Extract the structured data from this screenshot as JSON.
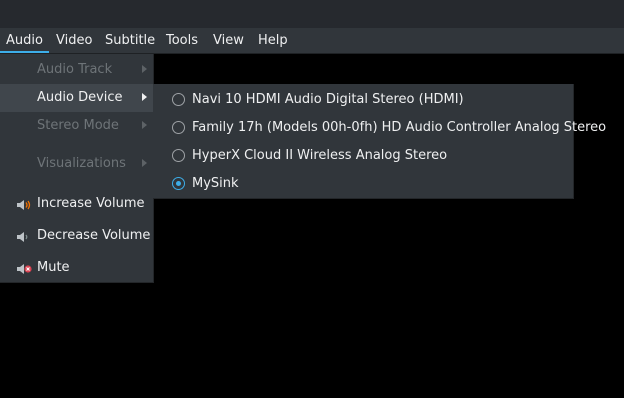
{
  "menubar": {
    "items": [
      {
        "label": "Audio"
      },
      {
        "label": "Video"
      },
      {
        "label": "Subtitle"
      },
      {
        "label": "Tools"
      },
      {
        "label": "View"
      },
      {
        "label": "Help"
      }
    ],
    "active": "Audio"
  },
  "audio_menu": {
    "items": [
      {
        "label": "Audio Track",
        "enabled": false,
        "has_submenu": true
      },
      {
        "label": "Audio Device",
        "enabled": true,
        "has_submenu": true,
        "highlighted": true
      },
      {
        "label": "Stereo Mode",
        "enabled": false,
        "has_submenu": true
      },
      {
        "label": "Visualizations",
        "enabled": false,
        "has_submenu": true
      },
      {
        "label": "Increase Volume",
        "enabled": true,
        "icon": "volume-high-icon"
      },
      {
        "label": "Decrease Volume",
        "enabled": true,
        "icon": "volume-low-icon"
      },
      {
        "label": "Mute",
        "enabled": true,
        "icon": "volume-muted-icon"
      }
    ]
  },
  "device_menu": {
    "items": [
      {
        "label": "Navi 10 HDMI Audio Digital Stereo (HDMI)",
        "checked": false
      },
      {
        "label": "Family 17h (Models 00h-0fh) HD Audio Controller Analog Stereo",
        "checked": false
      },
      {
        "label": "HyperX Cloud II Wireless Analog Stereo",
        "checked": false
      },
      {
        "label": "MySink",
        "checked": true
      }
    ]
  },
  "colors": {
    "accent": "#3daee9",
    "menu_bg": "#31363b",
    "disabled_text": "#6e7478",
    "mute_red": "#da4453"
  }
}
